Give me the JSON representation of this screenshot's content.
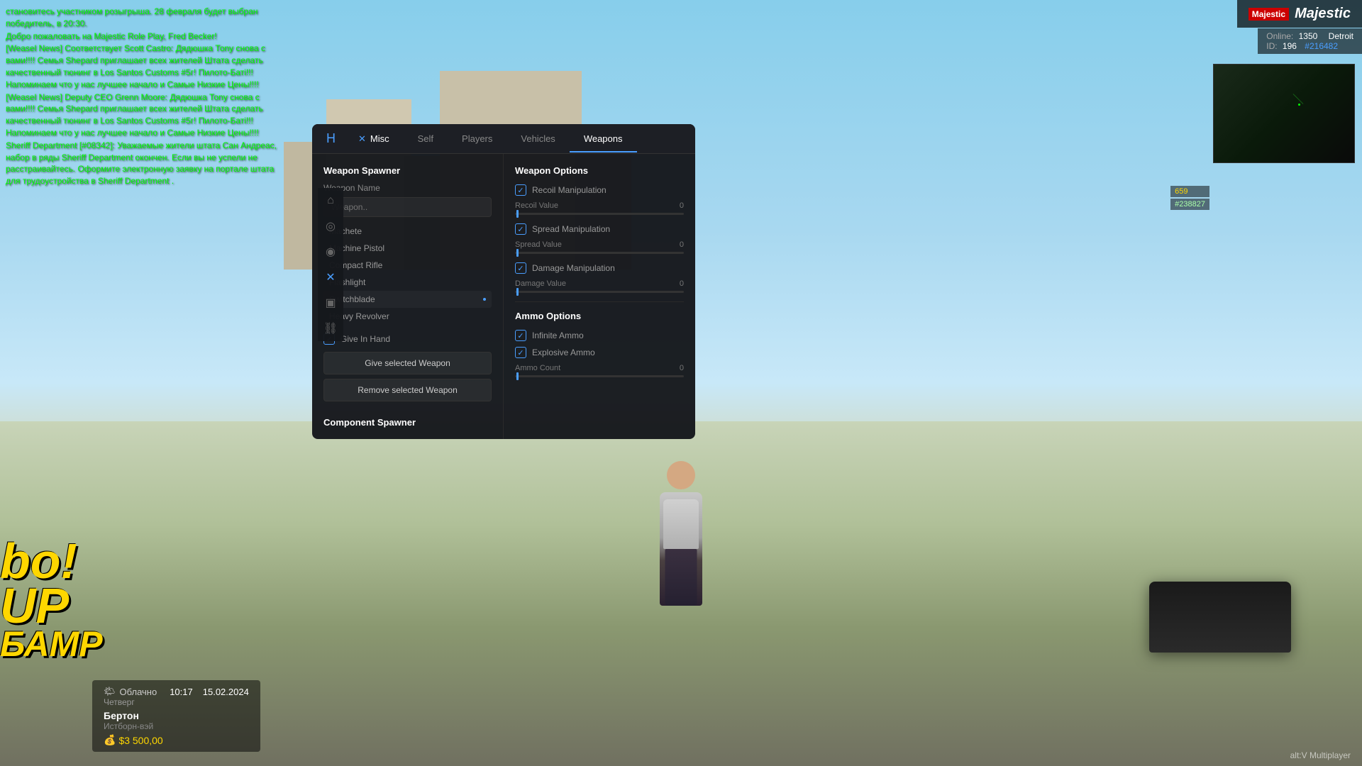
{
  "game": {
    "background_color": "#2a3a2a",
    "altv_label": "alt:V Multiplayer"
  },
  "chat": {
    "lines": [
      "становитесь участником розыгрыша. 28 февраля будет выбран победитель, в 20:30.",
      "Добро пожаловать на Majestic Role Play, Fred Becker!",
      "[Weasel News] Соответствует Scott Castro: Дядюшка Тоny снова с вами!!!! Семья Shepard приглашает всех жителей Штата сделать качественный тюнинг в Los Santos Customs #5г! Пилото-Батi!!! Напоминаем что у нас лучшее начало и Самые Низкие Цены!!!!",
      "[Weasel News] Deputy CEO Grenn Moore: Дядюшка Тоny снова с вами!!!! Семья Shepard приглашает всех жителей Штата сделать качественный тюнинг в Los Santos Customs #5г! Пилото-Батi!!! Напоминаем что у нас лучшее начало и Самые Низкие Цены!!!!",
      "Sheriff Department [#08342]: Уважаемые жители штата Сан Андреас, набор в ряды Sheriff Department окончен. Если вы не успели не расстраивайтесь. Оформите электронную заявку на портале штата для трудоустройства в Sheriff Department ."
    ]
  },
  "server": {
    "name": "Majestic",
    "online_label": "Online:",
    "online_count": "1350",
    "location": "Detroit",
    "id_label": "ID:",
    "player_id": "196",
    "tag": "#216482"
  },
  "player_overlay": {
    "id": "#238827",
    "coords": "659"
  },
  "hud": {
    "weather": "Облачно",
    "time": "10:17",
    "date": "15.02.2024",
    "day": "Четверг",
    "character_name": "Бертон",
    "character_role": "Истборн-вэй",
    "money": "$3 500,00"
  },
  "menu": {
    "icon": "H",
    "tabs": [
      {
        "id": "misc",
        "label": "Misc",
        "has_x": true
      },
      {
        "id": "self",
        "label": "Self"
      },
      {
        "id": "players",
        "label": "Players"
      },
      {
        "id": "vehicles",
        "label": "Vehicles"
      },
      {
        "id": "weapons",
        "label": "Weapons",
        "active": true
      }
    ],
    "side_icons": [
      {
        "id": "home",
        "symbol": "⌂"
      },
      {
        "id": "globe",
        "symbol": "◎"
      },
      {
        "id": "eye",
        "symbol": "◉"
      },
      {
        "id": "cross",
        "symbol": "✕",
        "active": true
      },
      {
        "id": "folder",
        "symbol": "▣"
      },
      {
        "id": "link",
        "symbol": "⛓"
      }
    ],
    "weapon_spawner": {
      "section_title": "Weapon Spawner",
      "weapon_name_label": "Weapon Name",
      "weapon_input_placeholder": "Weapon..",
      "weapons": [
        {
          "name": "Machete",
          "has_dot": false
        },
        {
          "name": "Machine Pistol",
          "has_dot": false
        },
        {
          "name": "Compact Rifle",
          "has_dot": false
        },
        {
          "name": "Flashlight",
          "has_dot": false
        },
        {
          "name": "Switchblade",
          "has_dot": true
        },
        {
          "name": "Heavy Revolver",
          "has_dot": false
        }
      ],
      "give_in_hand_label": "Give In Hand",
      "give_in_hand_checked": true,
      "give_btn_label": "Give selected Weapon",
      "remove_btn_label": "Remove selected Weapon",
      "component_spawner_label": "Component Spawner"
    },
    "weapon_options": {
      "title": "Weapon Options",
      "recoil_manipulation_label": "Recoil Manipulation",
      "recoil_manipulation_checked": true,
      "recoil_value_label": "Recoil Value",
      "recoil_value": "0",
      "spread_manipulation_label": "Spread Manipulation",
      "spread_manipulation_checked": true,
      "spread_value_label": "Spread Value",
      "spread_value": "0",
      "damage_manipulation_label": "Damage Manipulation",
      "damage_manipulation_checked": true,
      "damage_value_label": "Damage Value",
      "damage_value": "0"
    },
    "ammo_options": {
      "title": "Ammo Options",
      "infinite_ammo_label": "Infinite Ammo",
      "infinite_ammo_checked": true,
      "explosive_ammo_label": "Explosive Ammo",
      "explosive_ammo_checked": true,
      "ammo_count_label": "Ammo Count",
      "ammo_count_value": "0"
    }
  }
}
